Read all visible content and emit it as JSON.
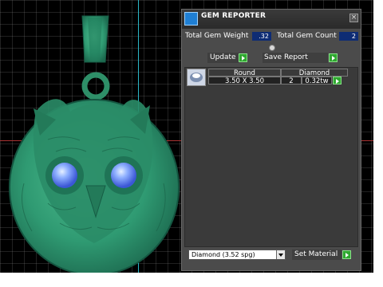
{
  "panel": {
    "title": "GEM REPORTER",
    "close_glyph": "×",
    "total_gem_weight_label": "Total Gem Weight",
    "total_gem_weight_value": ".32",
    "total_gem_count_label": "Total Gem Count",
    "total_gem_count_value": "2",
    "update_label": "Update",
    "save_report_label": "Save Report",
    "table": {
      "headers": [
        "Round",
        "Diamond"
      ],
      "row": {
        "size": "3.50 X 3.50",
        "count": "2",
        "weight": "0.32tw"
      }
    },
    "material_select_value": "Diamond    (3.52 spg)",
    "set_material_label": "Set Material"
  },
  "icons": {
    "logo": "gem-reporter-logo-icon",
    "close": "close-icon",
    "gem": "round-gem-icon",
    "arrow": "green-arrow-icon"
  },
  "colors": {
    "panel_bg": "#4b4b4b",
    "value_bg": "#0e2c74",
    "arrow_green": "#2fa830",
    "pendant_green": "#2f9a72",
    "gem_blue": "#6a8bff"
  }
}
